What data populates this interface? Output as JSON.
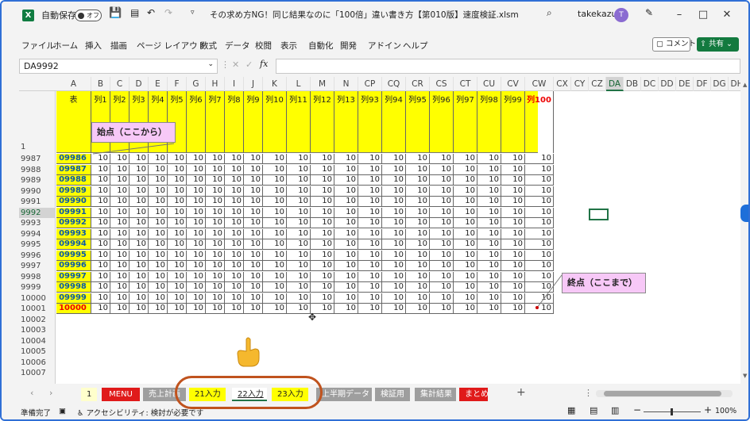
{
  "titlebar": {
    "autosave_label": "自動保存",
    "autosave_state": "オフ",
    "document_title": "その求め方NG！同じ結果なのに「100倍」違い書き方【第010版】速度検証.xlsm",
    "user_name": "takekazu",
    "user_initial": "T"
  },
  "ribbon": {
    "tabs": [
      "ファイル",
      "ホーム",
      "挿入",
      "描画",
      "ページ レイアウト",
      "数式",
      "データ",
      "校閲",
      "表示",
      "自動化",
      "開発",
      "アドイン",
      "ヘルプ"
    ],
    "comment_label": "コメント",
    "share_label": "共有"
  },
  "formula_bar": {
    "name_box": "DA9992",
    "fx_label": "fx",
    "formula": ""
  },
  "columns": [
    "A",
    "B",
    "C",
    "D",
    "E",
    "F",
    "G",
    "H",
    "I",
    "J",
    "K",
    "L",
    "M",
    "N",
    "CP",
    "CQ",
    "CR",
    "CS",
    "CT",
    "CU",
    "CV",
    "CW",
    "CX",
    "CY",
    "CZ",
    "DA",
    "DB",
    "DC",
    "DD",
    "DE",
    "DF",
    "DG",
    "DH"
  ],
  "selected_column": "DA",
  "header_row": {
    "row_number": "1",
    "cells": [
      "表",
      "列1",
      "列2",
      "列3",
      "列4",
      "列5",
      "列6",
      "列7",
      "列8",
      "列9",
      "列10",
      "列11",
      "列12",
      "列13",
      "列93",
      "列94",
      "列95",
      "列96",
      "列97",
      "列98",
      "列99",
      "列100"
    ]
  },
  "rows": [
    {
      "num": "9987",
      "key": "09986"
    },
    {
      "num": "9988",
      "key": "09987"
    },
    {
      "num": "9989",
      "key": "09988"
    },
    {
      "num": "9990",
      "key": "09989"
    },
    {
      "num": "9991",
      "key": "09990"
    },
    {
      "num": "9992",
      "key": "09991"
    },
    {
      "num": "9993",
      "key": "09992"
    },
    {
      "num": "9994",
      "key": "09993"
    },
    {
      "num": "9995",
      "key": "09994"
    },
    {
      "num": "9996",
      "key": "09995"
    },
    {
      "num": "9997",
      "key": "09996"
    },
    {
      "num": "9998",
      "key": "09997"
    },
    {
      "num": "9999",
      "key": "09998"
    },
    {
      "num": "10000",
      "key": "09999"
    },
    {
      "num": "10001",
      "key": "10000"
    }
  ],
  "empty_rows": [
    "10002",
    "10003",
    "10004",
    "10005",
    "10006",
    "10007"
  ],
  "selected_row": "9992",
  "cell_value": "10",
  "callouts": {
    "start": "始点（ここから）",
    "end": "終点（ここまで）"
  },
  "sheet_tabs": [
    {
      "label": "1",
      "bg": "#ffffcc",
      "color": "#222"
    },
    {
      "label": "MENU",
      "bg": "#e01a1a",
      "color": "#ffffff"
    },
    {
      "label": "売上計画",
      "bg": "#9e9e9e",
      "color": "#ffffff"
    },
    {
      "label": "21入力",
      "bg": "#ffff00",
      "color": "#222"
    },
    {
      "label": "22入力",
      "bg": "#ffffff",
      "color": "#222"
    },
    {
      "label": "23入力",
      "bg": "#ffff00",
      "color": "#222"
    },
    {
      "label": "上半期データ",
      "bg": "#9e9e9e",
      "color": "#ffffff"
    },
    {
      "label": "検証用",
      "bg": "#9e9e9e",
      "color": "#ffffff"
    },
    {
      "label": "集計結果",
      "bg": "#9e9e9e",
      "color": "#ffffff"
    },
    {
      "label": "まとめ",
      "bg": "#e01a1a",
      "color": "#ffffff"
    }
  ],
  "active_tab": "22入力",
  "statusbar": {
    "ready": "準備完了",
    "accessibility": "アクセシビリティ: 検討が必要です",
    "zoom": "100%"
  },
  "colors": {
    "accent_green": "#217346",
    "header_yellow": "#ffff00",
    "callout_pink": "#f7c8f7",
    "highlight_oval": "#c0531e"
  }
}
